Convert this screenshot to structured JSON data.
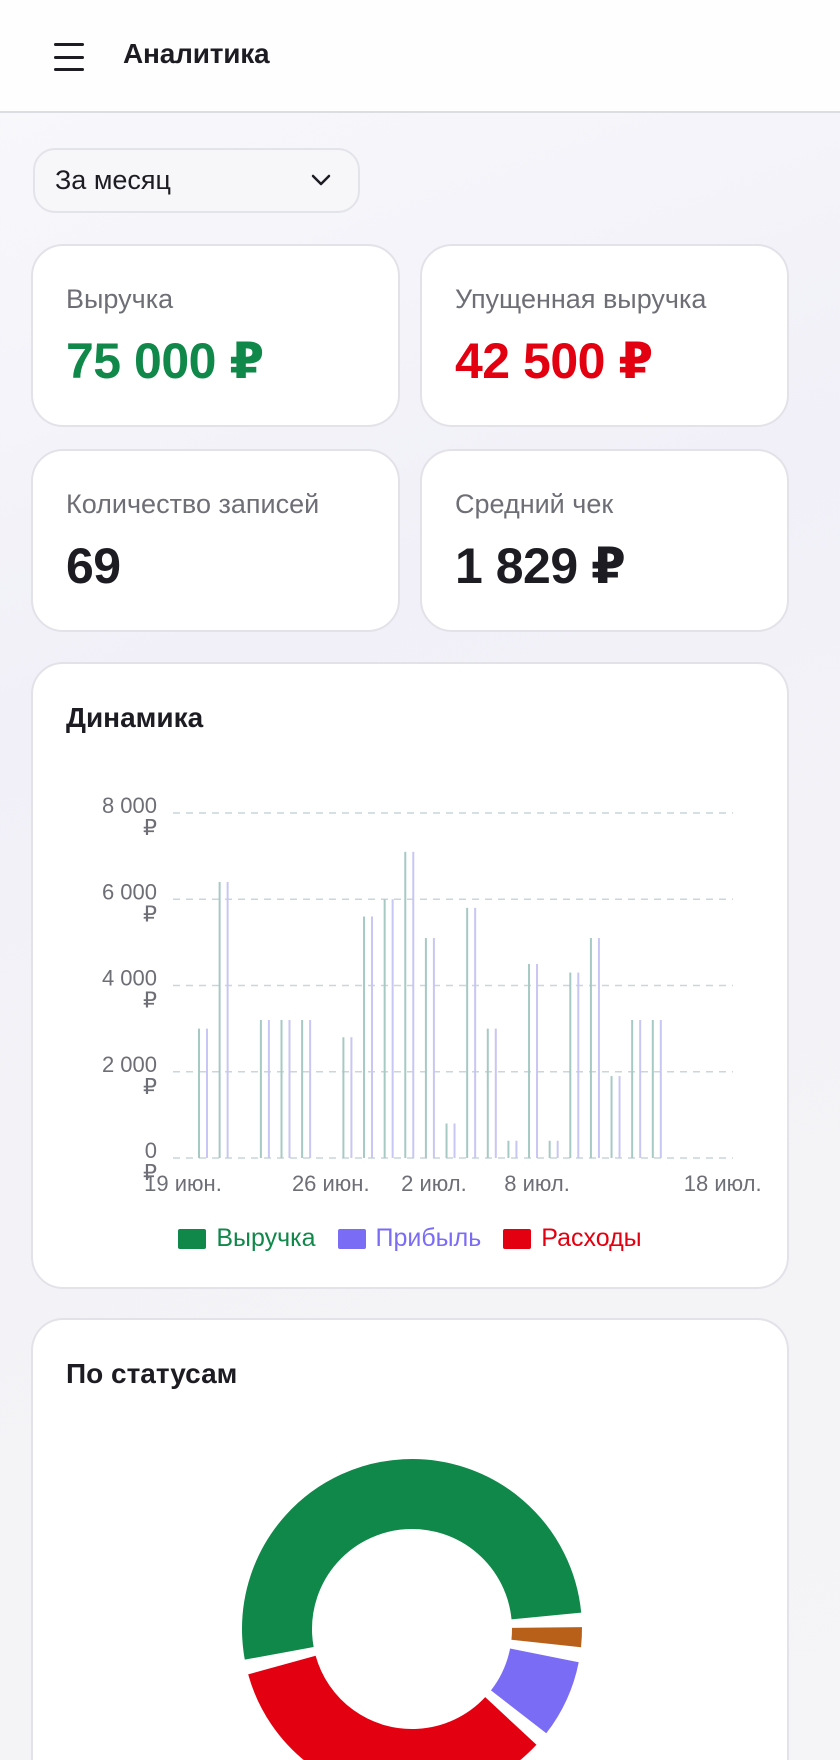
{
  "header": {
    "title": "Аналитика",
    "menu_icon": "hamburger-icon"
  },
  "period": {
    "selected": "За месяц",
    "icon": "chevron-down-icon"
  },
  "stats": [
    {
      "label": "Выручка",
      "value": "75 000 ₽",
      "color": "#10884a"
    },
    {
      "label": "Упущенная выручка",
      "value": "42 500 ₽",
      "color": "#e30010"
    },
    {
      "label": "Количество записей",
      "value": "69",
      "color": "#1c1c22"
    },
    {
      "label": "Средний чек",
      "value": "1 829 ₽",
      "color": "#1c1c22"
    }
  ],
  "dynamics": {
    "title": "Динамика",
    "chart_data": {
      "type": "bar",
      "ylim": [
        0,
        8000
      ],
      "yticks": [
        {
          "value": 0,
          "label": "0 ₽"
        },
        {
          "value": 2000,
          "label": "2 000 ₽"
        },
        {
          "value": 4000,
          "label": "4 000 ₽"
        },
        {
          "value": 6000,
          "label": "6 000 ₽"
        },
        {
          "value": 8000,
          "label": "8 000 ₽"
        }
      ],
      "xticks": [
        {
          "day": 0,
          "label": "19 июн."
        },
        {
          "day": 6,
          "label": "26 июн."
        },
        {
          "day": 11,
          "label": "2 июл."
        },
        {
          "day": 16,
          "label": "8 июл."
        },
        {
          "day": 25,
          "label": "18 июл."
        }
      ],
      "xrange": [
        0,
        25.5
      ],
      "grid": true,
      "legend_position": "bottom",
      "series": [
        {
          "name": "Выручка",
          "color": "#10884a",
          "values": [
            [
              0,
              3000
            ],
            [
              1,
              6400
            ],
            [
              3,
              3200
            ],
            [
              4,
              3200
            ],
            [
              5,
              3200
            ],
            [
              7,
              2800
            ],
            [
              8,
              5600
            ],
            [
              9,
              6000
            ],
            [
              10,
              7100
            ],
            [
              11,
              5100
            ],
            [
              12,
              800
            ],
            [
              13,
              5800
            ],
            [
              14,
              3000
            ],
            [
              15,
              400
            ],
            [
              16,
              4500
            ],
            [
              17,
              400
            ],
            [
              18,
              4300
            ],
            [
              19,
              5100
            ],
            [
              20,
              1900
            ],
            [
              21,
              3200
            ],
            [
              22,
              3200
            ]
          ]
        },
        {
          "name": "Прибыль",
          "color": "#7b6cf6",
          "values": [
            [
              0,
              3000
            ],
            [
              1,
              6400
            ],
            [
              3,
              3200
            ],
            [
              4,
              3200
            ],
            [
              5,
              3200
            ],
            [
              7,
              2800
            ],
            [
              8,
              5600
            ],
            [
              9,
              6000
            ],
            [
              10,
              7100
            ],
            [
              11,
              5100
            ],
            [
              12,
              800
            ],
            [
              13,
              5800
            ],
            [
              14,
              3000
            ],
            [
              15,
              400
            ],
            [
              16,
              4500
            ],
            [
              17,
              400
            ],
            [
              18,
              4300
            ],
            [
              19,
              5100
            ],
            [
              20,
              1900
            ],
            [
              21,
              3200
            ],
            [
              22,
              3200
            ]
          ]
        },
        {
          "name": "Расходы",
          "color": "#e30010",
          "values": []
        }
      ]
    }
  },
  "statuses": {
    "title": "По статусам",
    "chart_data": {
      "type": "pie",
      "variant": "donut",
      "slices": [
        {
          "value": 48,
          "color": "#10884a"
        },
        {
          "value": 32,
          "color": "#e30010"
        },
        {
          "value": 8,
          "color": "#7b6cf6"
        },
        {
          "value": 3,
          "color": "#b8601a"
        }
      ]
    }
  }
}
